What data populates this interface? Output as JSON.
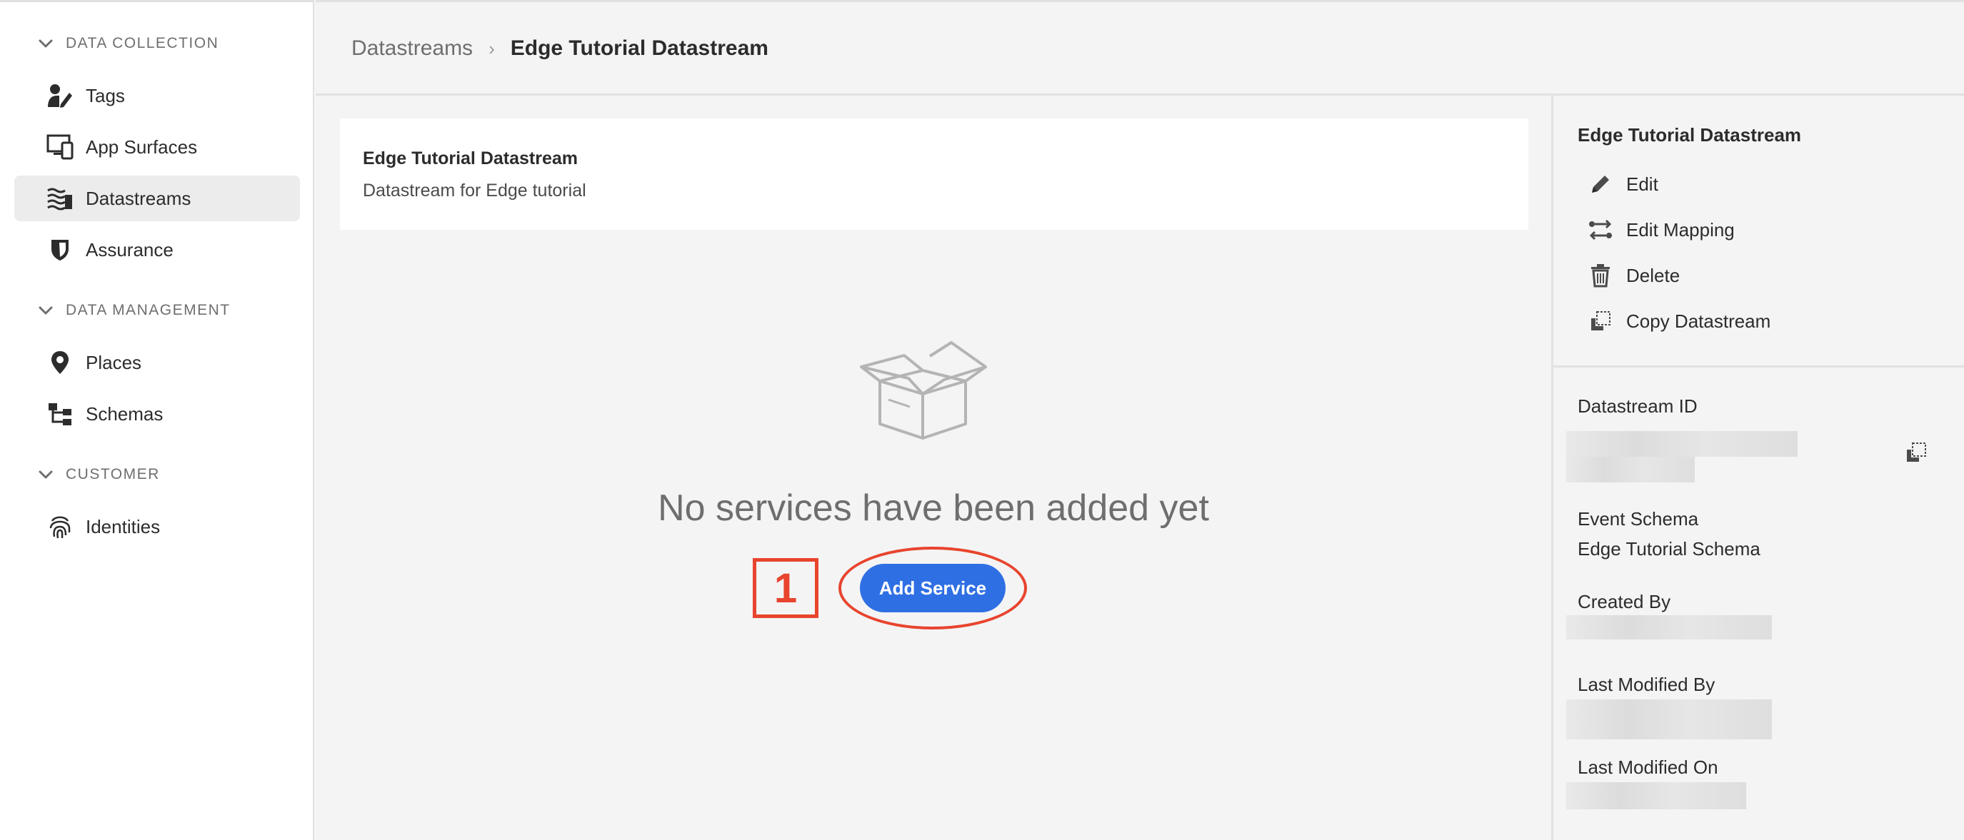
{
  "sidebar": {
    "sections": [
      {
        "label": "DATA COLLECTION"
      },
      {
        "label": "DATA MANAGEMENT"
      },
      {
        "label": "CUSTOMER"
      }
    ],
    "items": [
      {
        "label": "Tags",
        "icon": "tags-icon"
      },
      {
        "label": "App Surfaces",
        "icon": "app-surfaces-icon"
      },
      {
        "label": "Datastreams",
        "icon": "datastreams-icon",
        "active": true
      },
      {
        "label": "Assurance",
        "icon": "shield-icon"
      },
      {
        "label": "Places",
        "icon": "map-pin-icon"
      },
      {
        "label": "Schemas",
        "icon": "schema-icon"
      },
      {
        "label": "Identities",
        "icon": "fingerprint-icon"
      }
    ]
  },
  "header": {
    "breadcrumb_parent": "Datastreams",
    "breadcrumb_separator": "›",
    "breadcrumb_current": "Edge Tutorial Datastream"
  },
  "main": {
    "card_title": "Edge Tutorial Datastream",
    "card_description": "Datastream for Edge tutorial",
    "empty_message": "No services have been added yet",
    "step_number": "1",
    "add_service_label": "Add Service"
  },
  "panel": {
    "title": "Edge Tutorial Datastream",
    "actions": [
      {
        "label": "Edit",
        "icon": "pencil-icon"
      },
      {
        "label": "Edit Mapping",
        "icon": "mapping-icon"
      },
      {
        "label": "Delete",
        "icon": "trash-icon"
      },
      {
        "label": "Copy Datastream",
        "icon": "copy-icon"
      }
    ],
    "datastream_id_label": "Datastream ID",
    "event_schema_label": "Event Schema",
    "event_schema_value": "Edge Tutorial Schema",
    "created_by_label": "Created By",
    "last_modified_by_label": "Last Modified By",
    "last_modified_on_label": "Last Modified On"
  },
  "colors": {
    "accent": "#2f6fe4",
    "annotation": "#e8442e",
    "sidebar_bg": "#ffffff",
    "content_bg": "#f4f4f4"
  }
}
